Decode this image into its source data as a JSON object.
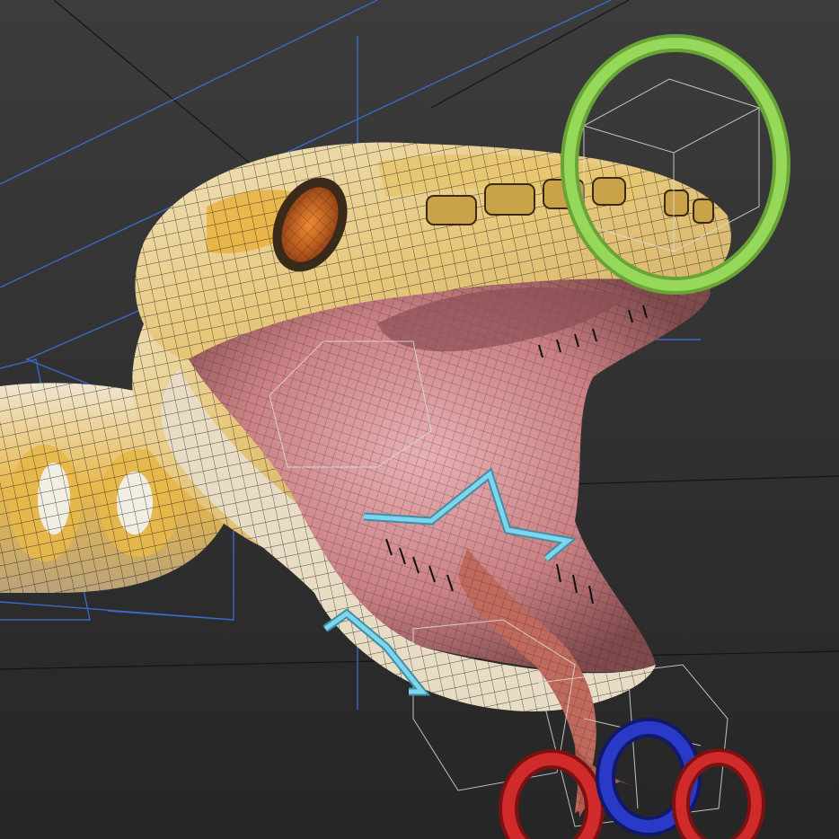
{
  "scene": {
    "subject": "snake-head-rig",
    "colors": {
      "background_top": "#3a3a3a",
      "background_bottom": "#262626",
      "skin_light": "#e8dcc4",
      "skin_yellow": "#e6b64a",
      "mouth_pink": "#d99aa0",
      "tongue_red": "#b06055",
      "wire": "#1a1a1a",
      "helper_box": "#dddddd",
      "blue_line": "#3b6fd6",
      "green_ring": "#8fd14f",
      "cyan_spline": "#6cc6dd",
      "red_ring": "#c42222",
      "blue_ring": "#2233b0",
      "eye_orange": "#e07a2a"
    },
    "controls": [
      {
        "name": "jaw-controller",
        "color": "cyan"
      },
      {
        "name": "head-controller",
        "color": "green"
      },
      {
        "name": "tongue-controllers",
        "color": "red-blue"
      }
    ]
  }
}
